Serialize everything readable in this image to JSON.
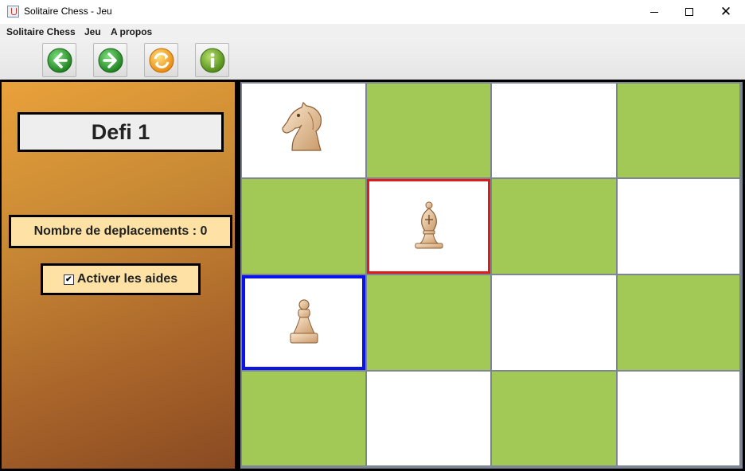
{
  "window": {
    "title": "Solitaire Chess - Jeu",
    "controls": {
      "minimize": "",
      "maximize": "",
      "close": "✕"
    }
  },
  "menu": {
    "items": [
      "Solitaire Chess",
      "Jeu",
      "A propos"
    ]
  },
  "toolbar": {
    "buttons": [
      {
        "name": "back",
        "icon": "arrow-left-icon",
        "color": "#2e9a2e"
      },
      {
        "name": "forward",
        "icon": "arrow-right-icon",
        "color": "#2e9a2e"
      },
      {
        "name": "restart",
        "icon": "refresh-icon",
        "color": "#f0a020"
      },
      {
        "name": "info",
        "icon": "info-icon",
        "color": "#6aa12a"
      }
    ]
  },
  "sidebar": {
    "challenge_title": "Defi 1",
    "moves_label": "Nombre de deplacements : 0",
    "help": {
      "label": "Activer les aides",
      "checked": true,
      "check_glyph": "✔"
    }
  },
  "board": {
    "rows": 4,
    "cols": 4,
    "colors": {
      "light": "#ffffff",
      "dark": "#a2c855",
      "selected_target": "#e01a1a",
      "selected_piece": "#0a14e6"
    },
    "pieces": [
      {
        "type": "knight",
        "row": 0,
        "col": 0
      },
      {
        "type": "bishop",
        "row": 1,
        "col": 1
      },
      {
        "type": "pawn",
        "row": 2,
        "col": 0
      }
    ],
    "highlights": [
      {
        "kind": "target",
        "row": 1,
        "col": 1
      },
      {
        "kind": "selected",
        "row": 2,
        "col": 0
      }
    ]
  }
}
